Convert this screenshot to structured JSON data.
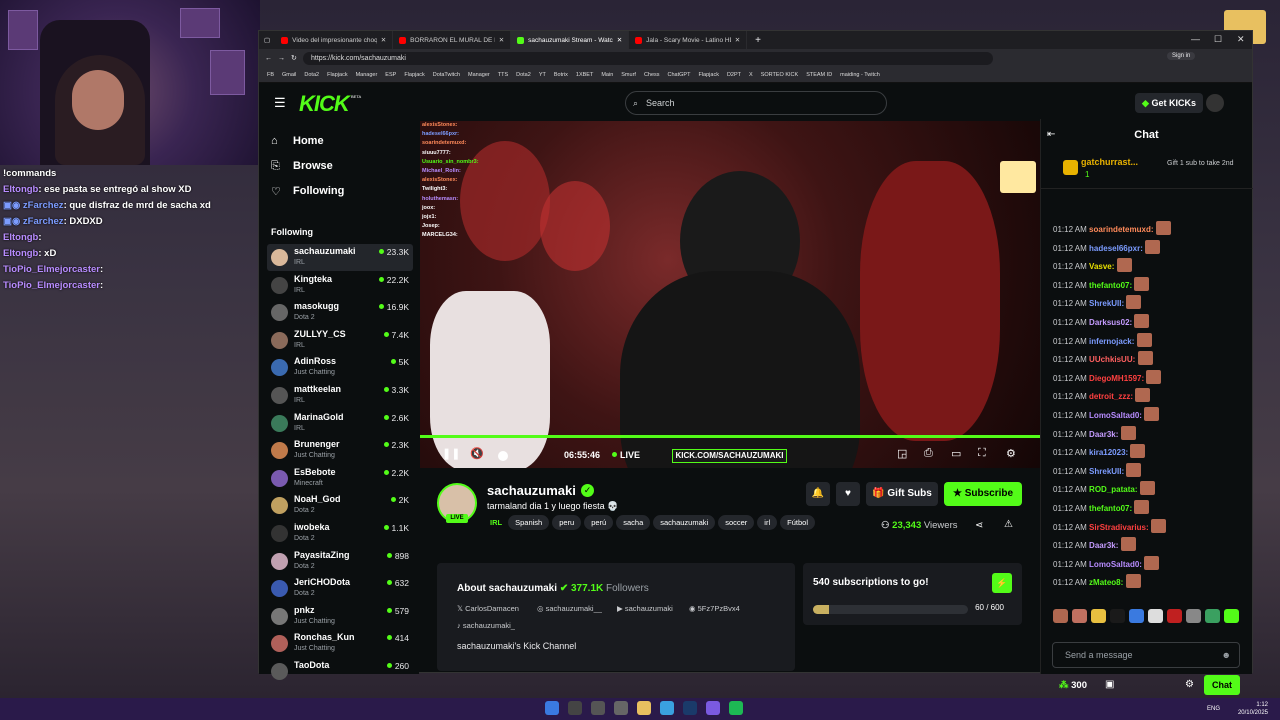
{
  "overlay_chat": [
    {
      "user": "!commands",
      "msg": "",
      "badge": false
    },
    {
      "user": "Eltongb",
      "msg": ": ese pasta se entregó al show XD",
      "badge": false
    },
    {
      "user": "zFarchez",
      "msg": ": que disfraz de mrd de sacha xd",
      "badge": true
    },
    {
      "user": "zFarchez",
      "msg": ": DXDXD",
      "badge": true
    },
    {
      "user": "Eltongb",
      "msg": ": ",
      "badge": false
    },
    {
      "user": "Eltongb",
      "msg": ": xD",
      "badge": false
    },
    {
      "user": "TioPio_Elmejorcaster",
      "msg": ": ",
      "badge": false
    },
    {
      "user": "TioPio_Elmejorcaster",
      "msg": ": ",
      "badge": false
    }
  ],
  "browser": {
    "tabs": [
      {
        "label": "Video del impresionante choque",
        "color": "#ff0000",
        "active": false
      },
      {
        "label": "BORRARON EL MURAL DE DRAGO",
        "color": "#ff0000",
        "active": false
      },
      {
        "label": "sachauzumaki Stream - Watch Liv",
        "color": "#53fc18",
        "active": true
      },
      {
        "label": "Jala - Scary Movie - Latino HD -",
        "color": "#ff0000",
        "active": false
      }
    ],
    "url": "https://kick.com/sachauzumaki",
    "bookmarks": [
      "FB",
      "Gmail",
      "Dota2",
      "Flapjack",
      "Manager",
      "ESP",
      "Flapjack",
      "DotaTwitch",
      "Manager",
      "TTS",
      "Dota2",
      "YT",
      "Botrix",
      "1XBET",
      "Main",
      "Smurf",
      "Chess",
      "ChatGPT",
      "Flapjack",
      "D2PT",
      "X",
      "SORTEO KICK",
      "STEAM ID",
      "maiding - Twitch"
    ],
    "sign_in": "Sign in"
  },
  "kick": {
    "logo": "KICK",
    "beta": "BETA",
    "search_placeholder": "Search",
    "get_kicks": "Get KICKs",
    "nav": {
      "home": "Home",
      "browse": "Browse",
      "following": "Following"
    },
    "following_header": "Following",
    "following": [
      {
        "name": "sachauzumaki",
        "category": "IRL",
        "viewers": "23.3K",
        "color": "#d9b89a"
      },
      {
        "name": "Kingteka",
        "category": "IRL",
        "viewers": "22.2K",
        "color": "#444"
      },
      {
        "name": "masokugg",
        "category": "Dota 2",
        "viewers": "16.9K",
        "color": "#666"
      },
      {
        "name": "ZULLYY_CS",
        "category": "IRL",
        "viewers": "7.4K",
        "color": "#8a6a5a"
      },
      {
        "name": "AdinRoss",
        "category": "Just Chatting",
        "viewers": "5K",
        "color": "#3a6ab0"
      },
      {
        "name": "mattkeelan",
        "category": "IRL",
        "viewers": "3.3K",
        "color": "#555"
      },
      {
        "name": "MarinaGold",
        "category": "IRL",
        "viewers": "2.6K",
        "color": "#3a7a5a"
      },
      {
        "name": "Brunenger",
        "category": "Just Chatting",
        "viewers": "2.3K",
        "color": "#c07a4a"
      },
      {
        "name": "EsBebote",
        "category": "Minecraft",
        "viewers": "2.2K",
        "color": "#7a5ab0"
      },
      {
        "name": "NoaH_God",
        "category": "Dota 2",
        "viewers": "2K",
        "color": "#c0a060"
      },
      {
        "name": "iwobeka",
        "category": "Dota 2",
        "viewers": "1.1K",
        "color": "#333"
      },
      {
        "name": "PayasitaZing",
        "category": "Dota 2",
        "viewers": "898",
        "color": "#c0a0b0"
      },
      {
        "name": "JeriCHODota",
        "category": "Dota 2",
        "viewers": "632",
        "color": "#3a5ab0"
      },
      {
        "name": "pnkz",
        "category": "Just Chatting",
        "viewers": "579",
        "color": "#777"
      },
      {
        "name": "Ronchas_Kun",
        "category": "Just Chatting",
        "viewers": "414",
        "color": "#b0605a"
      },
      {
        "name": "TaoDota",
        "category": "",
        "viewers": "260",
        "color": "#5a5a5a"
      }
    ]
  },
  "player": {
    "time": "06:55:46",
    "live": "LIVE",
    "watermark": "KICK.COM/SACHAUZUMAKI",
    "video_chat": [
      {
        "u": "alexisStonex:",
        "c": "#ff8a5a"
      },
      {
        "u": "hadesel66pxr:",
        "c": "#7c9cff"
      },
      {
        "u": "soarindetemuxd:",
        "c": "#ff8a5a"
      },
      {
        "u": "siuuu7777:",
        "c": "#ffffff"
      },
      {
        "u": "Usuario_sin_nombr3:",
        "c": "#53fc18"
      },
      {
        "u": "Michael_Rolin:",
        "c": "#b88cff"
      },
      {
        "u": "alexisStonex:",
        "c": "#ff8a5a"
      },
      {
        "u": "Twilight3:",
        "c": "#ffffff"
      },
      {
        "u": "holuthemasn:",
        "c": "#b88cff"
      },
      {
        "u": "joox:",
        "c": "#ffffff"
      },
      {
        "u": "jojx1:",
        "c": "#ffffff"
      },
      {
        "u": "Josep:",
        "c": "#ffffff"
      },
      {
        "u": "MARCELG34:",
        "c": "#ffffff"
      }
    ]
  },
  "stream": {
    "username": "sachauzumaki",
    "live_badge": "LIVE",
    "title": "tarmaland dia 1 y luego fiesta 💀",
    "category": "IRL",
    "tags": [
      "Spanish",
      "peru",
      "perú",
      "sacha",
      "sachauzumaki",
      "soccer",
      "irl",
      "Fútbol"
    ],
    "gift_subs": "Gift Subs",
    "subscribe": "Subscribe",
    "viewers": "23,343",
    "viewers_label": "Viewers"
  },
  "about": {
    "title": "About sachauzumaki",
    "followers": "377.1K",
    "followers_label": "Followers",
    "socials": [
      "CarlosDamacen",
      "sachauzumaki__",
      "sachauzumaki",
      "5Fz7PzBvx4",
      "sachauzumaki_"
    ],
    "description": "sachauzumaki's Kick Channel"
  },
  "goal": {
    "title": "540 subscriptions to go!",
    "current": 60,
    "target": 600,
    "count_text": "60 / 600"
  },
  "chat": {
    "title": "Chat",
    "pinned_user": "gatchurrast...",
    "pinned_count": "1",
    "gift_text": "Gift 1 sub to take 2nd",
    "messages": [
      {
        "time": "01:12 AM",
        "user": "soarindetemuxd:",
        "color": "#ff8a5a"
      },
      {
        "time": "01:12 AM",
        "user": "hadesel66pxr:",
        "color": "#7c9cff"
      },
      {
        "time": "01:12 AM",
        "user": "Vasve:",
        "color": "#e8e000"
      },
      {
        "time": "01:12 AM",
        "user": "thefanto07:",
        "color": "#53fc18"
      },
      {
        "time": "01:12 AM",
        "user": "ShrekUII:",
        "color": "#7c9cff"
      },
      {
        "time": "01:12 AM",
        "user": "Darksus02:",
        "color": "#c59cff"
      },
      {
        "time": "01:12 AM",
        "user": "infernojack:",
        "color": "#7c9cff"
      },
      {
        "time": "01:12 AM",
        "user": "UUchkisUU:",
        "color": "#ff6060"
      },
      {
        "time": "01:12 AM",
        "user": "DiegoMH1597:",
        "color": "#ff4040"
      },
      {
        "time": "01:12 AM",
        "user": "detroit_zzz:",
        "color": "#ff4040"
      },
      {
        "time": "01:12 AM",
        "user": "LomoSaltad0:",
        "color": "#b88cff"
      },
      {
        "time": "01:12 AM",
        "user": "Daar3k:",
        "color": "#c59cff"
      },
      {
        "time": "01:12 AM",
        "user": "kira12023:",
        "color": "#7c9cff"
      },
      {
        "time": "01:12 AM",
        "user": "ShrekUII:",
        "color": "#7c9cff"
      },
      {
        "time": "01:12 AM",
        "user": "ROD_patata:",
        "color": "#53fc18"
      },
      {
        "time": "01:12 AM",
        "user": "thefanto07:",
        "color": "#53fc18"
      },
      {
        "time": "01:12 AM",
        "user": "SirStradivarius:",
        "color": "#ff4040"
      },
      {
        "time": "01:12 AM",
        "user": "Daar3k:",
        "color": "#c59cff"
      },
      {
        "time": "01:12 AM",
        "user": "LomoSaltad0:",
        "color": "#b88cff"
      },
      {
        "time": "01:12 AM",
        "user": "zMateo8:",
        "color": "#53fc18"
      }
    ],
    "input_placeholder": "Send a message",
    "points": "300",
    "send": "Chat"
  },
  "taskbar": {
    "lang": "ENG",
    "time": "1:12",
    "date": "20/10/2025"
  }
}
